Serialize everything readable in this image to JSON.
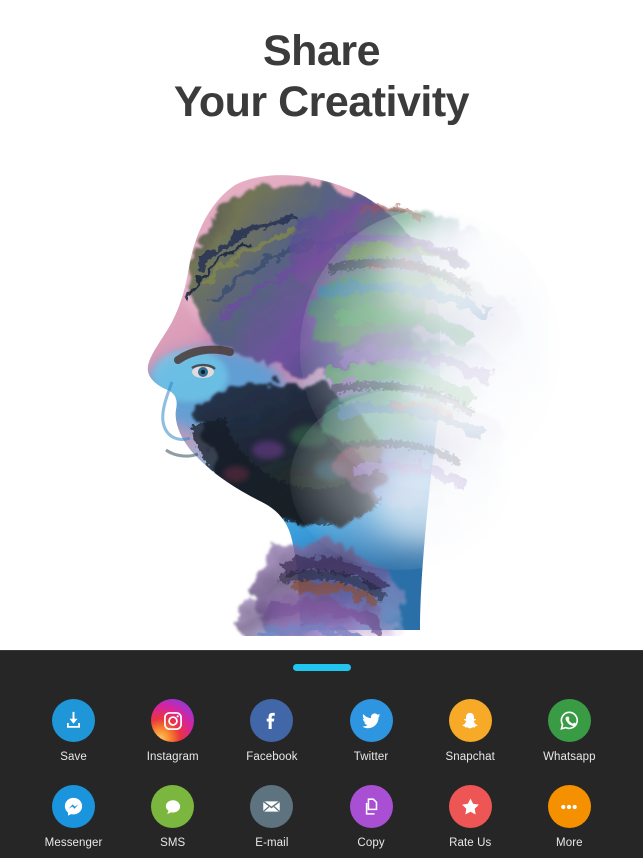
{
  "header": {
    "title_line_1": "Share",
    "title_line_2": "Your Creativity",
    "title_color": "#3b3b3b"
  },
  "artwork": {
    "name": "double-exposure-portrait",
    "description": "Colorful double-exposure watercolor portrait of a bearded man's profile dissolving into paint strokes",
    "background_color": "#ffffff",
    "palette": {
      "skin_pink": "#e5a6bd",
      "skin_magenta": "#c87fae",
      "face_blue": "#2f8fd6",
      "face_cyan": "#57c4e8",
      "beard_dark": "#1d2230",
      "hair_olive": "#8d9148",
      "hair_violet": "#6a4e9c",
      "splash_green": "#3f9b52",
      "splash_teal": "#2f7d93",
      "splash_red": "#c0484f",
      "splash_lilac": "#b39ddb",
      "wash_pale": "#e8eaf2"
    }
  },
  "share_sheet": {
    "background_color": "#262626",
    "handle_color": "#22c5f0",
    "label_color": "#e8e8e8",
    "rows": [
      [
        {
          "label": "Save",
          "icon": "download-icon",
          "color": "#1e96d8",
          "icon_color": "#ffffff"
        },
        {
          "label": "Instagram",
          "icon": "camera-icon",
          "color": "#d6249f",
          "icon_color": "#ffffff"
        },
        {
          "label": "Facebook",
          "icon": "facebook-f-icon",
          "color": "#4267a8",
          "icon_color": "#ffffff"
        },
        {
          "label": "Twitter",
          "icon": "bird-icon",
          "color": "#2e96e0",
          "icon_color": "#ffffff"
        },
        {
          "label": "Snapchat",
          "icon": "ghost-icon",
          "color": "#f7a928",
          "icon_color": "#ffffff"
        },
        {
          "label": "Whatsapp",
          "icon": "phone-bubble-icon",
          "color": "#3a9b45",
          "icon_color": "#ffffff"
        }
      ],
      [
        {
          "label": "Messenger",
          "icon": "messenger-bolt-icon",
          "color": "#1b94de",
          "icon_color": "#ffffff"
        },
        {
          "label": "SMS",
          "icon": "chat-bubble-icon",
          "color": "#7bb73f",
          "icon_color": "#ffffff"
        },
        {
          "label": "E-mail",
          "icon": "envelope-icon",
          "color": "#5e7380",
          "icon_color": "#ffffff"
        },
        {
          "label": "Copy",
          "icon": "copy-pages-icon",
          "color": "#a94fd4",
          "icon_color": "#ffffff"
        },
        {
          "label": "Rate Us",
          "icon": "star-icon",
          "color": "#ee5555",
          "icon_color": "#ffffff"
        },
        {
          "label": "More",
          "icon": "ellipsis-icon",
          "color": "#f59000",
          "icon_color": "#ffffff"
        }
      ]
    ]
  }
}
